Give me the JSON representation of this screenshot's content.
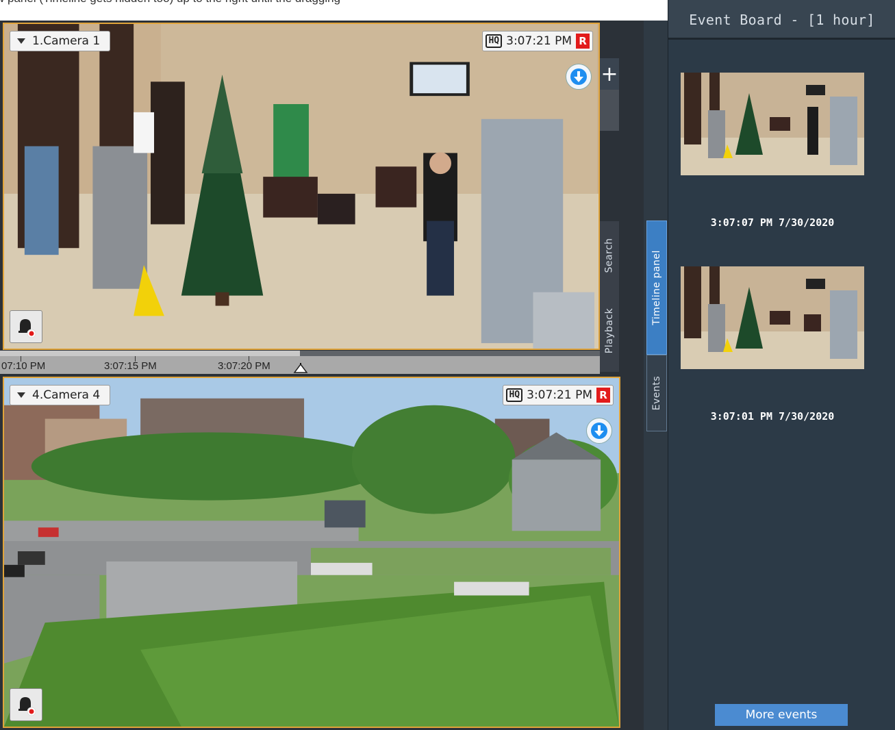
{
  "top_strip": {
    "caption": "w panel (Timeline gets hidden too) up to the right until the dragging"
  },
  "cameras": [
    {
      "label": "1.Camera 1",
      "quality": "HQ",
      "time": "3:07:21 PM",
      "rec": "R"
    },
    {
      "label": "4.Camera 4",
      "quality": "HQ",
      "time": "3:07:21 PM",
      "rec": "R"
    }
  ],
  "timeline": {
    "ticks": [
      "07:10 PM",
      "3:07:15 PM",
      "3:07:20 PM"
    ]
  },
  "side_controls": {
    "zoom_in": "+",
    "tab_search": "Search",
    "tab_playback": "Playback",
    "tab_timeline": "Timeline panel",
    "tab_events": "Events"
  },
  "event_board": {
    "title": "Event Board - [1 hour]",
    "events": [
      {
        "time": "3:07:07 PM 7/30/2020"
      },
      {
        "time": "3:07:01 PM 7/30/2020"
      }
    ],
    "more_label": "More events"
  },
  "colors": {
    "tile_border": "#e1a43a",
    "accent_blue": "#3c7fc4",
    "button_blue": "#4b8bd1",
    "rec_red": "#e21b1b",
    "board_bg": "#2c3a47"
  },
  "icons": [
    "dropdown-triangle-icon",
    "hq-icon",
    "download-arrow-icon",
    "alarm-bell-icon",
    "plus-icon"
  ]
}
